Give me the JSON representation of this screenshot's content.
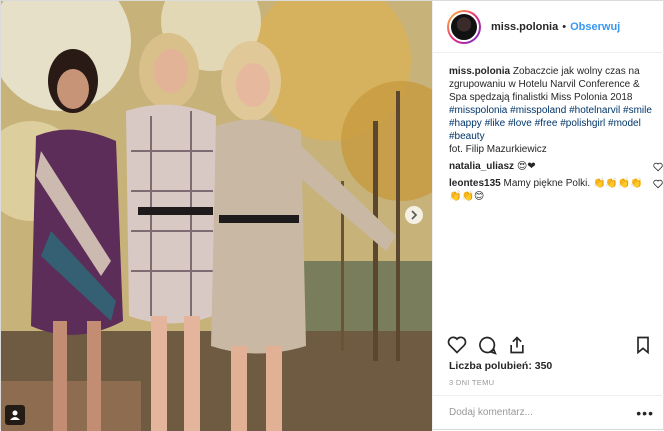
{
  "post": {
    "username": "miss.polonia",
    "separator": "•",
    "follow_label": "Obserwuj",
    "caption_user": "miss.polonia",
    "caption_text": "Zobaczcie jak wolny czas na zgrupowaniu w Hotelu Narvil Conference & Spa spędzają finalistki Miss Polonia 2018",
    "hashtags": [
      "#misspolonia",
      "#misspoland",
      "#hotelnarvil",
      "#smile",
      "#happy",
      "#like",
      "#love",
      "#free",
      "#polishgirl",
      "#model",
      "#beauty"
    ],
    "credit": "fot. Filip Mazurkiewicz",
    "comments": [
      {
        "user": "natalia_uliasz",
        "text": "😍❤"
      },
      {
        "user": "leontes135",
        "text": "Mamy piękne Polki. 👏👏👏👏👏👏😊"
      }
    ],
    "likes_label": "Liczba polubień: 350",
    "time_label": "3 DNI TEMU",
    "comment_placeholder": "Dodaj komentarz...",
    "more_label": "•••"
  },
  "icons": {
    "heart": "heart-icon",
    "comment": "comment-icon",
    "share": "share-icon",
    "bookmark": "bookmark-icon",
    "user_tag": "user-tag-icon",
    "next": "chevron-right-icon"
  },
  "colors": {
    "link_blue": "#3897f0",
    "hashtag": "#003569",
    "muted": "#999999"
  }
}
